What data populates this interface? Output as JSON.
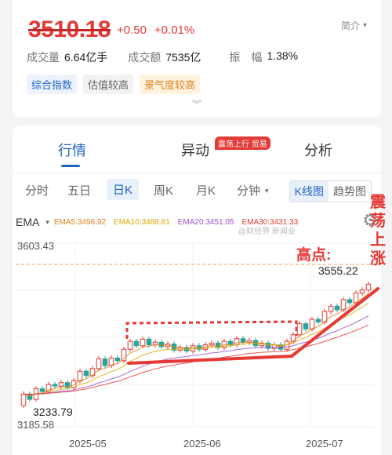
{
  "quote": {
    "price": "3510.18",
    "change": "+0.50",
    "change_pct": "+0.01%",
    "intro": "简介",
    "volume_label": "成交量",
    "volume": "6.64亿手",
    "turnover_label": "成交额",
    "turnover": "7535亿",
    "amplitude_label": "振　幅",
    "amplitude": "1.38%"
  },
  "tags": [
    "综合指数",
    "估值较高",
    "景气度较高"
  ],
  "main_tabs": {
    "items": [
      "行情",
      "异动",
      "分析"
    ],
    "badge": "震荡上行 贸易"
  },
  "k_tabs": [
    "分时",
    "五日",
    "日K",
    "周K",
    "月K",
    "分钟"
  ],
  "k_mode": [
    "K线图",
    "趋势图"
  ],
  "ema": {
    "label": "EMA",
    "items": [
      {
        "text": "EMA5:3496.92",
        "color": "#e0821a"
      },
      {
        "text": "EMA10:3488.81",
        "color": "#d9a800"
      },
      {
        "text": "EMA20:3451.05",
        "color": "#9c4dcc"
      },
      {
        "text": "EMA30:3431.33",
        "color": "#e53935"
      }
    ],
    "watermark": "@财经界 新闻业"
  },
  "chart_data": {
    "type": "candlestick",
    "y_top_label": "3603.43",
    "y_bottom_label": "3185.58",
    "ylim": [
      3185.58,
      3603.43
    ],
    "high_label": "3555.22",
    "low_label": "3233.79",
    "x_ticks": [
      "2025-05",
      "2025-06",
      "2025-07"
    ],
    "annotations": {
      "high": "高点:",
      "trend": "震荡上涨"
    },
    "colors": {
      "up": "#e53935",
      "down": "#26a69a",
      "ref": "#e8a15a",
      "annot": "#e53935"
    },
    "candles": [
      [
        3234,
        3260
      ],
      [
        3260,
        3248
      ],
      [
        3248,
        3272
      ],
      [
        3272,
        3266
      ],
      [
        3266,
        3282
      ],
      [
        3282,
        3278
      ],
      [
        3278,
        3286
      ],
      [
        3286,
        3275
      ],
      [
        3275,
        3290
      ],
      [
        3290,
        3312
      ],
      [
        3312,
        3302
      ],
      [
        3302,
        3318
      ],
      [
        3318,
        3340
      ],
      [
        3340,
        3325
      ],
      [
        3325,
        3342
      ],
      [
        3342,
        3336
      ],
      [
        3336,
        3362
      ],
      [
        3362,
        3380
      ],
      [
        3380,
        3370
      ],
      [
        3370,
        3385
      ],
      [
        3385,
        3372
      ],
      [
        3372,
        3378
      ],
      [
        3378,
        3368
      ],
      [
        3368,
        3374
      ],
      [
        3374,
        3360
      ],
      [
        3360,
        3366
      ],
      [
        3366,
        3358
      ],
      [
        3358,
        3370
      ],
      [
        3370,
        3362
      ],
      [
        3362,
        3372
      ],
      [
        3372,
        3376
      ],
      [
        3376,
        3366
      ],
      [
        3366,
        3380
      ],
      [
        3380,
        3372
      ],
      [
        3372,
        3386
      ],
      [
        3386,
        3378
      ],
      [
        3378,
        3382
      ],
      [
        3382,
        3370
      ],
      [
        3370,
        3376
      ],
      [
        3376,
        3364
      ],
      [
        3364,
        3372
      ],
      [
        3372,
        3362
      ],
      [
        3362,
        3380
      ],
      [
        3380,
        3395
      ],
      [
        3395,
        3420
      ],
      [
        3420,
        3408
      ],
      [
        3408,
        3430
      ],
      [
        3430,
        3424
      ],
      [
        3424,
        3448
      ],
      [
        3448,
        3460
      ],
      [
        3460,
        3452
      ],
      [
        3452,
        3475
      ],
      [
        3475,
        3468
      ],
      [
        3468,
        3490
      ],
      [
        3490,
        3497
      ],
      [
        3497,
        3510
      ]
    ]
  }
}
